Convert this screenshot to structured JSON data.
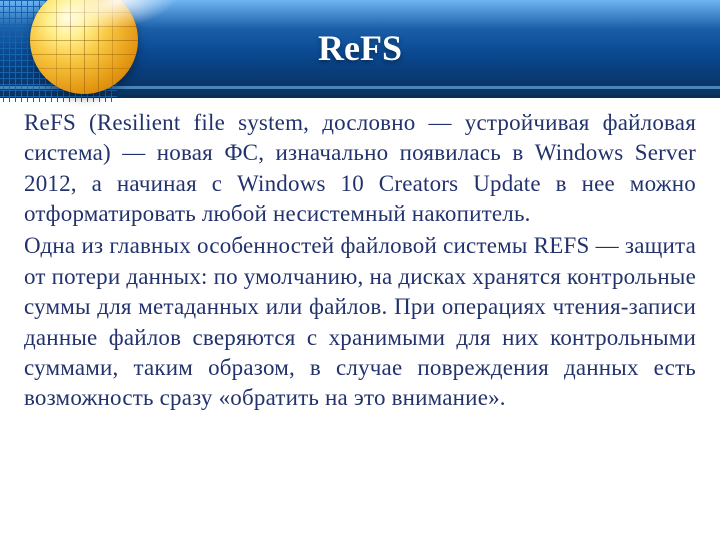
{
  "header": {
    "title": "ReFS"
  },
  "content": {
    "p1": "ReFS (Resilient file system, дословно — устройчивая файловая система) — новая ФС, изначально появилась в Windows Server 2012, а начиная с Windows 10 Creators Update в нее можно отформатировать любой несистемный накопитель.",
    "p2": "Одна из главных особенностей файловой системы REFS — защита от потери данных: по умолчанию, на дисках хранятся контрольные суммы для метаданных или файлов. При операциях чтения-записи данные файлов сверяются с хранимыми для них контрольными суммами, таким образом, в случае повреждения данных есть возможность сразу «обратить на это внимание»."
  }
}
